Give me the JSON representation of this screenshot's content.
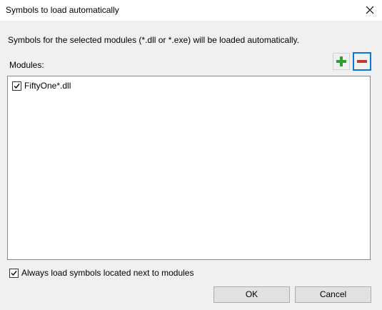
{
  "window": {
    "title": "Symbols to load automatically",
    "close_icon": "close-icon"
  },
  "description": "Symbols for the selected modules (*.dll or *.exe) will be loaded automatically.",
  "modules": {
    "label": "Modules:",
    "add_icon": "plus-icon",
    "add_color": "#2e9e2e",
    "remove_icon": "minus-icon",
    "remove_color": "#c0392b",
    "items": [
      {
        "label": "FiftyOne*.dll",
        "checked": true
      }
    ]
  },
  "options": {
    "always_load_label": "Always load symbols located next to modules",
    "always_load_checked": true
  },
  "buttons": {
    "ok": "OK",
    "cancel": "Cancel"
  }
}
